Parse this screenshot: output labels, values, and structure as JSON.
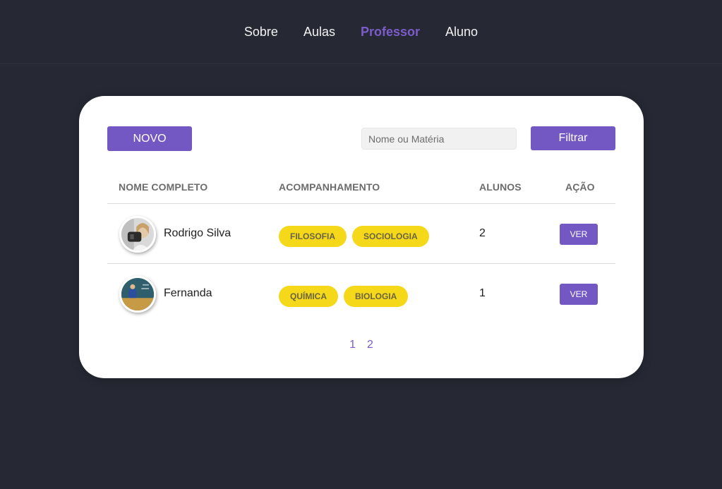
{
  "nav": {
    "items": [
      {
        "label": "Sobre"
      },
      {
        "label": "Aulas"
      },
      {
        "label": "Professor",
        "active": true
      },
      {
        "label": "Aluno"
      }
    ]
  },
  "toolbar": {
    "new_label": "NOVO",
    "search_placeholder": "Nome ou Matéria",
    "search_value": "",
    "filter_label": "Filtrar"
  },
  "table": {
    "headers": [
      "NOME COMPLETO",
      "ACOMPANHAMENTO",
      "ALUNOS",
      "AÇÃO"
    ],
    "rows": [
      {
        "name": "Rodrigo Silva",
        "tags": [
          "FILOSOFIA",
          "SOCIOLOGIA"
        ],
        "students": "2",
        "action": "VER",
        "avatar_icon": "person-photo-avatar"
      },
      {
        "name": "Fernanda",
        "tags": [
          "QUÍMICA",
          "BIOLOGIA"
        ],
        "students": "1",
        "action": "VER",
        "avatar_icon": "classroom-photo-avatar"
      }
    ]
  },
  "pagination": {
    "pages": [
      "1",
      "2"
    ]
  },
  "colors": {
    "background": "#262833",
    "accent": "#7357c2",
    "active_nav": "#7b5cc8",
    "tag": "#f4d819",
    "card": "#ffffff"
  }
}
